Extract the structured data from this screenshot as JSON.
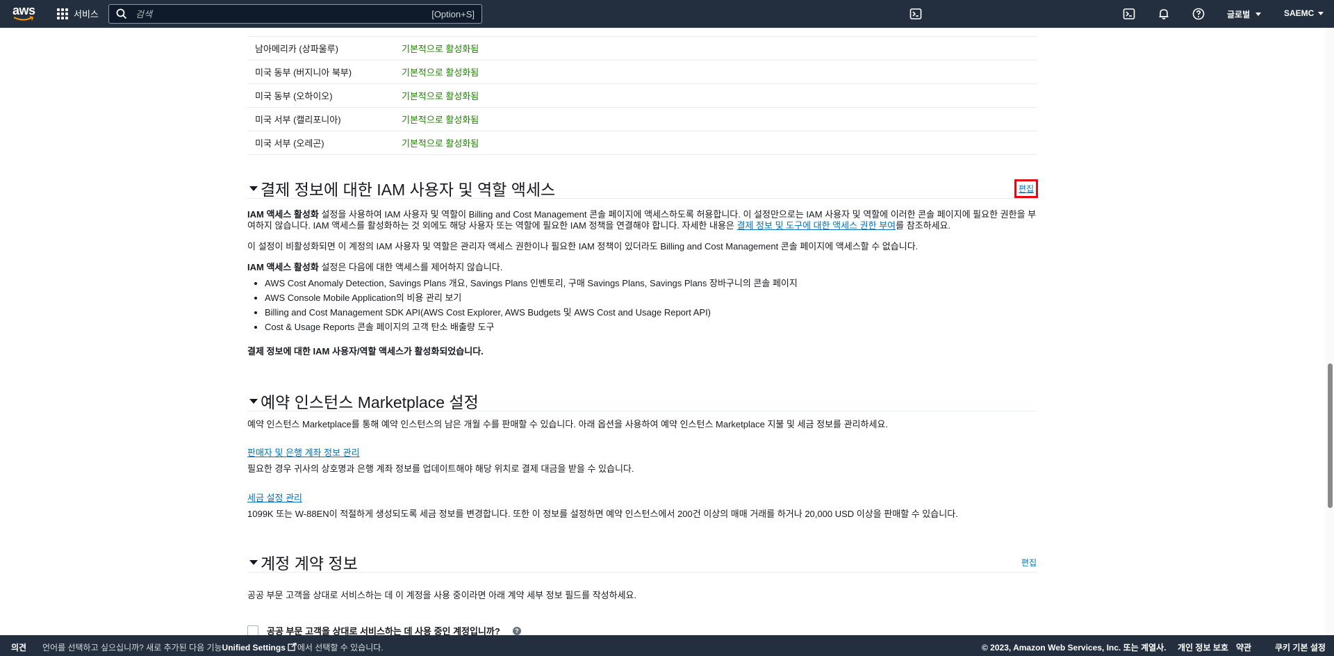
{
  "nav": {
    "logo_text": "aws",
    "services_label": "서비스",
    "search_placeholder": "검색",
    "search_shortcut": "[Option+S]",
    "region_label": "글로벌",
    "account_label": "SAEMC",
    "icons": [
      "cloudshell-icon",
      "bell-icon",
      "help-icon"
    ]
  },
  "regions": [
    {
      "name": "남아메리카 (상파울루)",
      "status": "기본적으로 활성화됨"
    },
    {
      "name": "미국 동부 (버지니아 북부)",
      "status": "기본적으로 활성화됨"
    },
    {
      "name": "미국 동부 (오하이오)",
      "status": "기본적으로 활성화됨"
    },
    {
      "name": "미국 서부 (캘리포니아)",
      "status": "기본적으로 활성화됨"
    },
    {
      "name": "미국 서부 (오레곤)",
      "status": "기본적으로 활성화됨"
    }
  ],
  "iam_section": {
    "title": "결제 정보에 대한 IAM 사용자 및 역할 액세스",
    "edit_label": "편집",
    "p1_bold": "IAM 액세스 활성화",
    "p1_text": " 설정을 사용하여 IAM 사용자 및 역할이 Billing and Cost Management 콘솔 페이지에 액세스하도록 허용합니다. 이 설정만으로는 IAM 사용자 및 역할에 이러한 콘솔 페이지에 필요한 권한을 부여하지 않습니다. IAM 액세스를 활성화하는 것 외에도 해당 사용자 또는 역할에 필요한 IAM 정책을 연결해야 합니다. 자세한 내용은 ",
    "p1_link": "결제 정보 및 도구에 대한 액세스 권한 부여",
    "p1_suffix": "를 참조하세요.",
    "p2": "이 설정이 비활성화되면 이 계정의 IAM 사용자 및 역할은 관리자 액세스 권한이나 필요한 IAM 정책이 있더라도 Billing and Cost Management 콘솔 페이지에 액세스할 수 없습니다.",
    "p3_bold": "IAM 액세스 활성화",
    "p3_text": " 설정은 다음에 대한 액세스를 제어하지 않습니다.",
    "bullets": [
      "AWS Cost Anomaly Detection, Savings Plans 개요, Savings Plans 인벤토리, 구매 Savings Plans, Savings Plans 장바구니의 콘솔 페이지",
      "AWS Console Mobile Application의 비용 관리 보기",
      "Billing and Cost Management SDK API(AWS Cost Explorer, AWS Budgets 및 AWS Cost and Usage Report API)",
      "Cost & Usage Reports 콘솔 페이지의 고객 탄소 배출량 도구"
    ],
    "status_text": "결제 정보에 대한 IAM 사용자/역할 액세스가 활성화되었습니다."
  },
  "ri_section": {
    "title": "예약 인스턴스 Marketplace 설정",
    "intro": "예약 인스턴스 Marketplace를 통해 예약 인스턴스의 남은 개월 수를 판매할 수 있습니다. 아래 옵션을 사용하여 예약 인스턴스 Marketplace 지불 및 세금 정보를 관리하세요.",
    "link1": "판매자 및 은행 계좌 정보 관리",
    "link1_desc": "필요한 경우 귀사의 상호명과 은행 계좌 정보를 업데이트해야 해당 위치로 결제 대금을 받을 수 있습니다.",
    "link2": "세금 설정 관리",
    "link2_desc": "1099K 또는 W-88EN이 적절하게 생성되도록 세금 정보를 변경합니다. 또한 이 정보를 설정하면 예약 인스턴스에서 200건 이상의 매매 거래를 하거나 20,000 USD 이상을 판매할 수 있습니다."
  },
  "contract_section": {
    "title": "계정 계약 정보",
    "edit_label": "편집",
    "intro": "공공 부문 고객을 상대로 서비스하는 데 이 계정을 사용 중이라면 아래 계약 세부 정보 필드를 작성하세요.",
    "checkbox_label": "공공 부문 고객을 상대로 서비스하는 데 사용 중인 계정입니까?",
    "help": "?"
  },
  "footer": {
    "feedback": "의견",
    "lang_text_before": "언어를 선택하고 싶으십니까? 새로 추가된 다음 기능",
    "lang_link": "Unified Settings",
    "lang_text_after": "에서 선택할 수 있습니다.",
    "copyright": "© 2023, Amazon Web Services, Inc. 또는 계열사.",
    "privacy": "개인 정보 보호",
    "terms": "약관",
    "cookies": "쿠키 기본 설정"
  },
  "colors": {
    "nav_bg": "#232f3e",
    "link": "#0073bb",
    "success": "#1d8102",
    "highlight_box": "#e50914"
  }
}
